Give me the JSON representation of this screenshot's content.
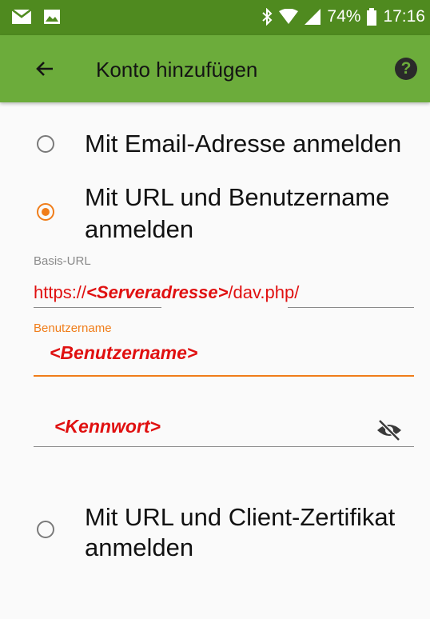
{
  "status_bar": {
    "battery": "74%",
    "time": "17:16"
  },
  "app_bar": {
    "title": "Konto hinzufügen",
    "help_label": "?"
  },
  "options": {
    "email": {
      "label": "Mit Email-Adresse anmelden",
      "selected": false
    },
    "url_user": {
      "label_line1": "Mit URL und Benutzername",
      "label_line2": "anmelden",
      "selected": true
    },
    "url_cert": {
      "label_line1": "Mit URL und Client-Zertifikat",
      "label_line2": "anmelden",
      "selected": false
    }
  },
  "form": {
    "base_url": {
      "label": "Basis-URL",
      "value_prefix": "https://",
      "value_placeholder": "<Serveradresse>",
      "value_suffix": "/dav.php/"
    },
    "username": {
      "label": "Benutzername",
      "value": "<Benutzername>"
    },
    "password": {
      "value": "<Kennwort>"
    }
  },
  "colors": {
    "status_bar": "#4f8a1f",
    "app_bar": "#6cac3b",
    "accent": "#f07d1a",
    "annotation": "#e01010"
  },
  "icons": [
    "mail-icon",
    "image-icon",
    "bluetooth-icon",
    "wifi-icon",
    "signal-icon",
    "battery-icon",
    "back-arrow-icon",
    "help-icon",
    "visibility-off-icon"
  ]
}
